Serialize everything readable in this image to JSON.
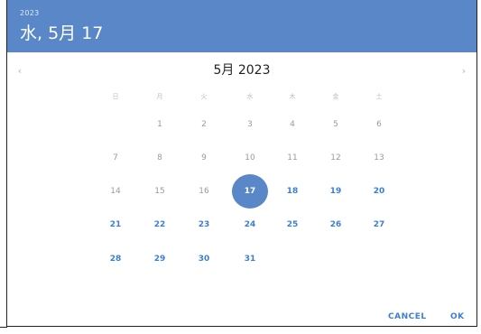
{
  "header": {
    "year": "2023",
    "date": "水, 5月 17"
  },
  "calendar": {
    "month_title": "5月 2023",
    "prev_icon": "‹",
    "next_icon": "›",
    "weekdays": [
      "日",
      "月",
      "火",
      "水",
      "木",
      "金",
      "土"
    ],
    "weeks": [
      [
        "",
        "1",
        "2",
        "3",
        "4",
        "5",
        "6"
      ],
      [
        "7",
        "8",
        "9",
        "10",
        "11",
        "12",
        "13"
      ],
      [
        "14",
        "15",
        "16",
        "17",
        "18",
        "19",
        "20"
      ],
      [
        "21",
        "22",
        "23",
        "24",
        "25",
        "26",
        "27"
      ],
      [
        "28",
        "29",
        "30",
        "31",
        "",
        "",
        ""
      ]
    ],
    "selected_day": "17"
  },
  "buttons": {
    "cancel": "CANCEL",
    "ok": "OK"
  },
  "colors": {
    "header": "#5a87c7",
    "accent": "#3c7ed6",
    "past": "#9a9a9a"
  }
}
